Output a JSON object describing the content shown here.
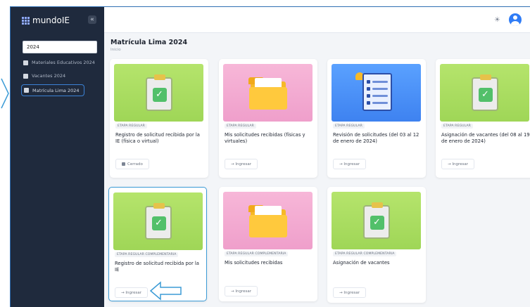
{
  "app": {
    "name": "mundoIE"
  },
  "sidebar": {
    "year_value": "2024",
    "items": [
      {
        "label": "Materiales Educativos 2024"
      },
      {
        "label": "Vacantes 2024"
      },
      {
        "label": "Matrícula Lima 2024"
      }
    ]
  },
  "page": {
    "title": "Matrícula Lima 2024",
    "breadcrumb": "Inicio"
  },
  "cards": [
    {
      "tag": "ETAPA REGULAR",
      "title": "Registro de solicitud recibida por la IE (física o virtual)",
      "button": "Cerrado",
      "button_icon": "lock-icon"
    },
    {
      "tag": "ETAPA REGULAR",
      "title": "Mis solicitudes recibidas (físicas y virtuales)",
      "button": "→ Ingresar",
      "button_icon": "arrow-right-icon"
    },
    {
      "tag": "ETAPA REGULAR",
      "title": "Revisión de solicitudes (del 03 al 12 de enero de 2024)",
      "button": "→ Ingresar",
      "button_icon": "arrow-right-icon"
    },
    {
      "tag": "ETAPA REGULAR",
      "title": "Asignación de vacantes (del 08 al 19 de enero de 2024)",
      "button": "→ Ingresar",
      "button_icon": "arrow-right-icon"
    },
    {
      "tag": "ETAPA REGULAR COMPLEMENTARIA",
      "title": "Registro de solicitud recibida por la IE",
      "button": "→ Ingresar",
      "button_icon": "arrow-right-icon"
    },
    {
      "tag": "ETAPA REGULAR COMPLEMENTARIA",
      "title": "Mis solicitudes recibidas",
      "button": "→ Ingresar",
      "button_icon": "arrow-right-icon"
    },
    {
      "tag": "ETAPA REGULAR COMPLEMENTARIA",
      "title": "Asignación de vacantes",
      "button": "→ Ingresar",
      "button_icon": "arrow-right-icon"
    }
  ],
  "colors": {
    "sidebar_bg": "#1f2a3d",
    "accent": "#2f7cf6",
    "highlight": "#3b9bd6"
  }
}
